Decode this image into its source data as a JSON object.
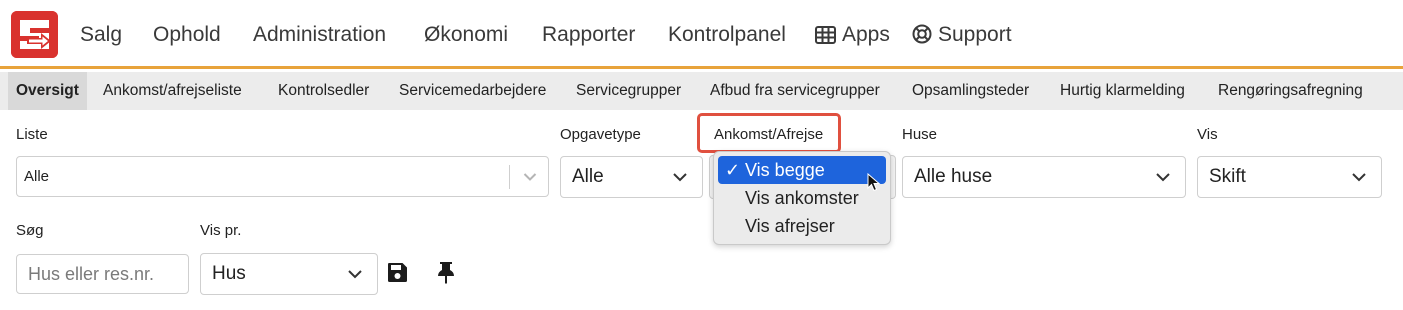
{
  "nav": {
    "items": [
      {
        "label": "Salg"
      },
      {
        "label": "Ophold"
      },
      {
        "label": "Administration"
      },
      {
        "label": "Økonomi"
      },
      {
        "label": "Rapporter"
      },
      {
        "label": "Kontrolpanel"
      },
      {
        "label": "Apps",
        "icon": "grid-icon"
      },
      {
        "label": "Support",
        "icon": "lifebuoy-icon"
      }
    ],
    "accent": "#e8a33b",
    "logo_color": "#d9322e"
  },
  "subnav": {
    "items": [
      {
        "label": "Oversigt",
        "active": true
      },
      {
        "label": "Ankomst/afrejseliste"
      },
      {
        "label": "Kontrolsedler"
      },
      {
        "label": "Servicemedarbejdere"
      },
      {
        "label": "Servicegrupper"
      },
      {
        "label": "Afbud fra servicegrupper"
      },
      {
        "label": "Opsamlingsteder"
      },
      {
        "label": "Hurtig klarmelding"
      },
      {
        "label": "Rengøringsafregning"
      }
    ]
  },
  "filters": {
    "liste": {
      "label": "Liste",
      "value": "Alle"
    },
    "opgavetype": {
      "label": "Opgavetype",
      "value": "Alle"
    },
    "ankomst": {
      "label": "Ankomst/Afrejse",
      "options": [
        {
          "label": "Vis begge",
          "selected": true
        },
        {
          "label": "Vis ankomster",
          "selected": false
        },
        {
          "label": "Vis afrejser",
          "selected": false
        }
      ],
      "check": "✓",
      "highlight_color": "#e0503f",
      "selected_color": "#1e64dc"
    },
    "huse": {
      "label": "Huse",
      "value": "Alle huse"
    },
    "vis": {
      "label": "Vis",
      "value": "Skift"
    },
    "sog": {
      "label": "Søg",
      "placeholder": "Hus eller res.nr."
    },
    "vispr": {
      "label": "Vis pr.",
      "value": "Hus"
    }
  },
  "actions": {
    "save_icon": "save-icon",
    "pin_icon": "pin-icon"
  }
}
